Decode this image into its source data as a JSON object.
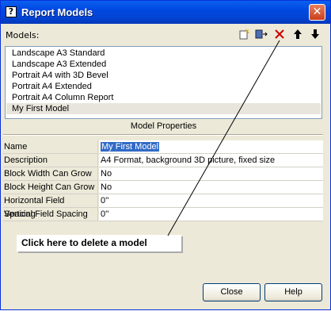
{
  "window": {
    "title": "Report Models",
    "title_icon": "?",
    "close_glyph": "✕"
  },
  "models": {
    "label": "Models:",
    "toolbar": {
      "new_icon": "new-model-icon",
      "copy_icon": "copy-model-icon",
      "delete_icon": "delete-model-icon",
      "up_icon": "move-up-icon",
      "down_icon": "move-down-icon"
    },
    "items": [
      "Landscape A3 Standard",
      "Landscape A3 Extended",
      "Portrait A4 with 3D Bevel",
      "Portrait A4 Extended",
      "Portrait A4 Column Report",
      "My First Model"
    ],
    "selected_index": 5
  },
  "properties": {
    "header": "Model Properties",
    "rows": [
      {
        "name": "Name",
        "value": "My First Model"
      },
      {
        "name": "Description",
        "value": "A4 Format, background 3D picture, fixed size"
      },
      {
        "name": "Block Width Can Grow",
        "value": "No"
      },
      {
        "name": "Block Height Can Grow",
        "value": "No"
      },
      {
        "name": "Horizontal Field Spacing",
        "value": "0''"
      },
      {
        "name": "Vertical Field Spacing",
        "value": "0''"
      }
    ]
  },
  "callout": {
    "text": "Click here to delete a model"
  },
  "buttons": {
    "close": "Close",
    "help": "Help"
  },
  "colors": {
    "title_bar": "#0048e0",
    "dialog_bg": "#ece9d8",
    "selection": "#316ac5",
    "delete_icon": "#cc0000"
  }
}
